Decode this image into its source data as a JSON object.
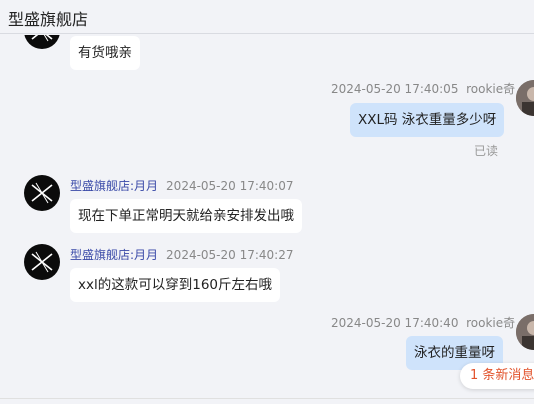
{
  "header": {
    "shop_name": "型盛旗舰店"
  },
  "messages": [
    {
      "type": "shop",
      "text": "有货哦亲"
    },
    {
      "type": "user",
      "timestamp": "2024-05-20 17:40:05",
      "sender": "rookie奇",
      "text": "XXL码 泳衣重量多少呀",
      "status": "已读"
    },
    {
      "type": "shop",
      "sender": "型盛旗舰店:月月",
      "timestamp": "2024-05-20 17:40:07",
      "text": "现在下单正常明天就给亲安排发出哦"
    },
    {
      "type": "shop",
      "sender": "型盛旗舰店:月月",
      "timestamp": "2024-05-20 17:40:27",
      "text": "xxl的这款可以穿到160斤左右哦"
    },
    {
      "type": "user",
      "timestamp": "2024-05-20 17:40:40",
      "sender": "rookie奇",
      "text": "泳衣的重量呀"
    }
  ],
  "new_message_notice": "1 条新消息",
  "colors": {
    "user_bubble": "#cfe3fb",
    "shop_bubble": "#ffffff",
    "sender_name": "#3a4aa8",
    "notice": "#e2532c"
  }
}
